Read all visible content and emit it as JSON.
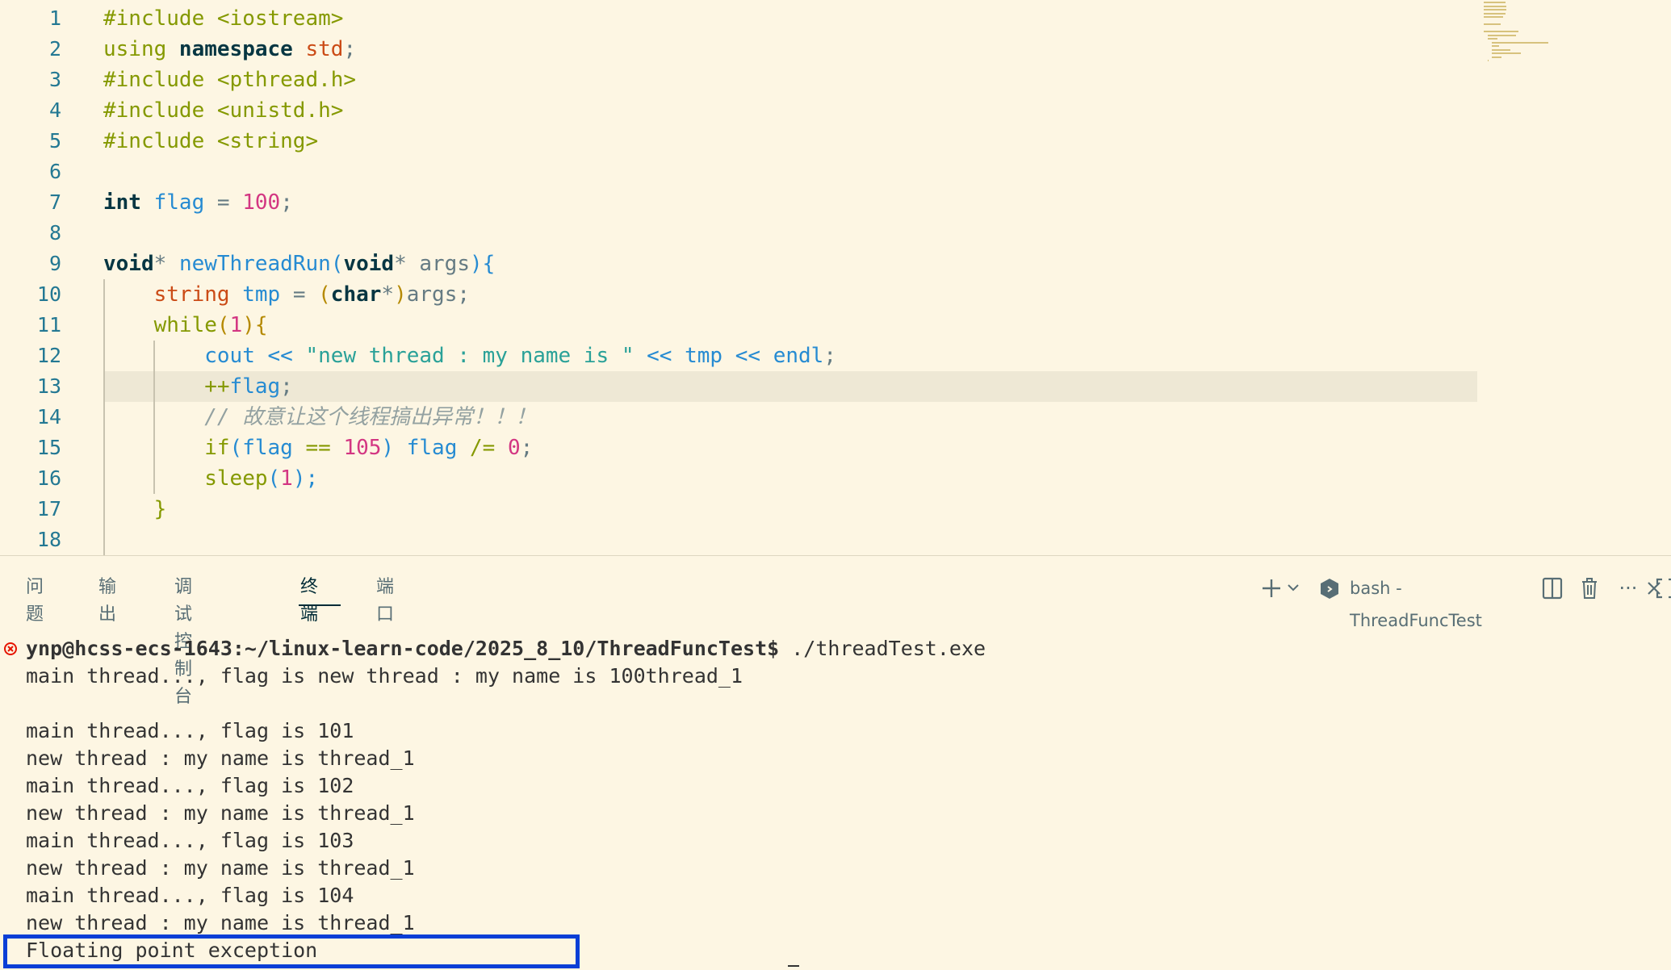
{
  "editor": {
    "lines": [
      {
        "n": "1",
        "tokens": [
          [
            "#include ",
            "kw"
          ],
          [
            "<iostream>",
            "kw"
          ]
        ]
      },
      {
        "n": "2",
        "tokens": [
          [
            "using ",
            "kw"
          ],
          [
            "namespace ",
            "kwb"
          ],
          [
            "std",
            "type"
          ],
          [
            ";",
            "pl"
          ]
        ]
      },
      {
        "n": "3",
        "tokens": [
          [
            "#include ",
            "kw"
          ],
          [
            "<pthread.h>",
            "kw"
          ]
        ]
      },
      {
        "n": "4",
        "tokens": [
          [
            "#include ",
            "kw"
          ],
          [
            "<unistd.h>",
            "kw"
          ]
        ]
      },
      {
        "n": "5",
        "tokens": [
          [
            "#include ",
            "kw"
          ],
          [
            "<string>",
            "kw"
          ]
        ]
      },
      {
        "n": "6",
        "tokens": []
      },
      {
        "n": "7",
        "tokens": [
          [
            "int ",
            "kwb"
          ],
          [
            "flag",
            "var"
          ],
          [
            " = ",
            "pl"
          ],
          [
            "100",
            "num"
          ],
          [
            ";",
            "pl"
          ]
        ]
      },
      {
        "n": "8",
        "tokens": []
      },
      {
        "n": "9",
        "tokens": [
          [
            "void",
            "kwb"
          ],
          [
            "* ",
            "pl"
          ],
          [
            "newThreadRun",
            "var"
          ],
          [
            "(",
            "b3"
          ],
          [
            "void",
            "kwb"
          ],
          [
            "* ",
            "pl"
          ],
          [
            "args",
            "pl"
          ],
          [
            "){",
            "b3"
          ]
        ]
      },
      {
        "n": "10",
        "tokens": [
          [
            "    ",
            "pl"
          ],
          [
            "string ",
            "type"
          ],
          [
            "tmp",
            "var"
          ],
          [
            " = ",
            "pl"
          ],
          [
            "(",
            "b1"
          ],
          [
            "char",
            "kwb"
          ],
          [
            "*",
            "pl"
          ],
          [
            ")",
            "b1"
          ],
          [
            "args;",
            "pl"
          ]
        ]
      },
      {
        "n": "11",
        "tokens": [
          [
            "    ",
            "pl"
          ],
          [
            "while",
            "kw"
          ],
          [
            "(",
            "b1"
          ],
          [
            "1",
            "num"
          ],
          [
            "){",
            "b1"
          ]
        ]
      },
      {
        "n": "12",
        "tokens": [
          [
            "        ",
            "pl"
          ],
          [
            "cout",
            "var"
          ],
          [
            " << ",
            "var"
          ],
          [
            "\"new thread : my name is \"",
            "str"
          ],
          [
            " << ",
            "var"
          ],
          [
            "tmp",
            "var"
          ],
          [
            " << ",
            "var"
          ],
          [
            "endl",
            "var"
          ],
          [
            ";",
            "pl"
          ]
        ]
      },
      {
        "n": "13",
        "tokens": [
          [
            "        ",
            "pl"
          ],
          [
            "++",
            "kw"
          ],
          [
            "flag",
            "var"
          ],
          [
            ";",
            "pl"
          ]
        ]
      },
      {
        "n": "14",
        "tokens": [
          [
            "        ",
            "pl"
          ],
          [
            "// 故意让这个线程搞出异常！！！",
            "cmt"
          ]
        ]
      },
      {
        "n": "15",
        "tokens": [
          [
            "        ",
            "pl"
          ],
          [
            "if",
            "kw"
          ],
          [
            "(",
            "b3"
          ],
          [
            "flag",
            "var"
          ],
          [
            " == ",
            "kw"
          ],
          [
            "105",
            "num"
          ],
          [
            ") ",
            "b3"
          ],
          [
            "flag",
            "var"
          ],
          [
            " /= ",
            "kw"
          ],
          [
            "0",
            "num"
          ],
          [
            ";",
            "pl"
          ]
        ]
      },
      {
        "n": "16",
        "tokens": [
          [
            "        ",
            "pl"
          ],
          [
            "sleep",
            "kw"
          ],
          [
            "(",
            "b3"
          ],
          [
            "1",
            "num"
          ],
          [
            ");",
            "b3"
          ]
        ]
      },
      {
        "n": "17",
        "tokens": [
          [
            "    ",
            "pl"
          ],
          [
            "}",
            "b2"
          ]
        ]
      },
      {
        "n": "18",
        "tokens": []
      }
    ]
  },
  "panel": {
    "tabs": [
      {
        "id": "problems",
        "label": "问题"
      },
      {
        "id": "output",
        "label": "输出"
      },
      {
        "id": "debug-console",
        "label": "调试控制台"
      },
      {
        "id": "terminal",
        "label": "终端",
        "active": true
      },
      {
        "id": "ports",
        "label": "端口"
      }
    ],
    "toolbar": {
      "terminal_name": "bash - ThreadFuncTest",
      "icons": [
        "plus-icon",
        "chevron-down-icon",
        "terminal-icon",
        "split-icon",
        "trash-icon",
        "more-icon",
        "maximize-icon",
        "close-icon"
      ]
    }
  },
  "terminal": {
    "prompt": "ynp@hcss-ecs-1643:~/linux-learn-code/2025_8_10/ThreadFuncTest$",
    "command": " ./threadTest.exe",
    "output": [
      "main thread..., flag is new thread : my name is 100thread_1",
      "",
      "main thread..., flag is 101",
      "new thread : my name is thread_1",
      "main thread..., flag is 102",
      "new thread : my name is thread_1",
      "main thread..., flag is 103",
      "new thread : my name is thread_1",
      "main thread..., flag is 104",
      "new thread : my name is thread_1",
      "Floating point exception"
    ],
    "colors": {
      "error_dot": "#e51400",
      "highlight_border": "#0a3fd6"
    }
  }
}
